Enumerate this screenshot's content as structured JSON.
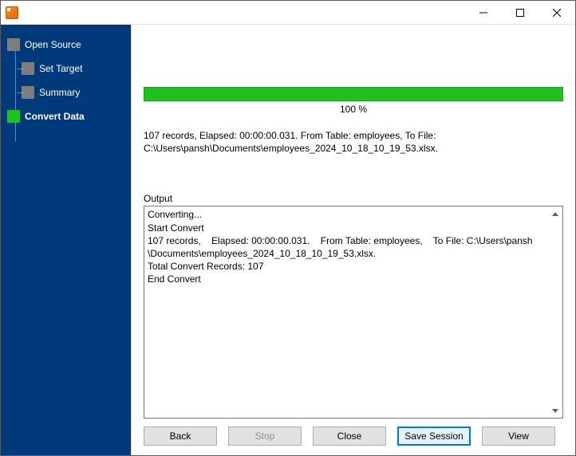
{
  "window": {
    "title": ""
  },
  "sidebar": {
    "items": [
      {
        "label": "Open Source",
        "level": "root",
        "active": false
      },
      {
        "label": "Set Target",
        "level": "child",
        "active": false
      },
      {
        "label": "Summary",
        "level": "child",
        "active": false
      },
      {
        "label": "Convert Data",
        "level": "root",
        "active": true
      }
    ]
  },
  "progress": {
    "percent_label": "100 %"
  },
  "status": {
    "line1": "107 records,    Elapsed: 00:00:00.031.    From Table: employees,    To File:",
    "line2": "C:\\Users\\pansh\\Documents\\employees_2024_10_18_10_19_53.xlsx."
  },
  "output": {
    "label": "Output",
    "text": "Converting...\nStart Convert\n107 records,    Elapsed: 00:00:00.031.    From Table: employees,    To File: C:\\Users\\pansh\n\\Documents\\employees_2024_10_18_10_19_53.xlsx.\nTotal Convert Records: 107\nEnd Convert"
  },
  "buttons": {
    "back": "Back",
    "stop": "Stop",
    "close": "Close",
    "save_session": "Save Session",
    "view": "View"
  }
}
